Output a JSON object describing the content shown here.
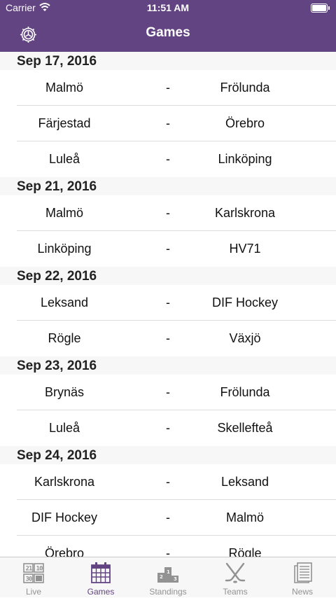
{
  "status_bar": {
    "carrier": "Carrier",
    "time": "11:51 AM"
  },
  "nav": {
    "title": "Games"
  },
  "sections": [
    {
      "date": "Sep 17, 2016",
      "games": [
        {
          "home": "Malmö",
          "sep": "-",
          "away": "Frölunda"
        },
        {
          "home": "Färjestad",
          "sep": "-",
          "away": "Örebro"
        },
        {
          "home": "Luleå",
          "sep": "-",
          "away": "Linköping"
        }
      ]
    },
    {
      "date": "Sep 21, 2016",
      "games": [
        {
          "home": "Malmö",
          "sep": "-",
          "away": "Karlskrona"
        },
        {
          "home": "Linköping",
          "sep": "-",
          "away": "HV71"
        }
      ]
    },
    {
      "date": "Sep 22, 2016",
      "games": [
        {
          "home": "Leksand",
          "sep": "-",
          "away": "DIF Hockey"
        },
        {
          "home": "Rögle",
          "sep": "-",
          "away": "Växjö"
        }
      ]
    },
    {
      "date": "Sep 23, 2016",
      "games": [
        {
          "home": "Brynäs",
          "sep": "-",
          "away": "Frölunda"
        },
        {
          "home": "Luleå",
          "sep": "-",
          "away": "Skellefteå"
        }
      ]
    },
    {
      "date": "Sep 24, 2016",
      "games": [
        {
          "home": "Karlskrona",
          "sep": "-",
          "away": "Leksand"
        },
        {
          "home": "DIF Hockey",
          "sep": "-",
          "away": "Malmö"
        },
        {
          "home": "Örebro",
          "sep": "-",
          "away": "Rögle"
        }
      ]
    }
  ],
  "tabs": [
    {
      "label": "Live",
      "icon": "scoreboard-icon"
    },
    {
      "label": "Games",
      "icon": "calendar-icon",
      "active": true
    },
    {
      "label": "Standings",
      "icon": "podium-icon"
    },
    {
      "label": "Teams",
      "icon": "hockey-sticks-icon"
    },
    {
      "label": "News",
      "icon": "newspaper-icon"
    }
  ],
  "colors": {
    "accent": "#634482",
    "tab_inactive": "#929292",
    "section_bg": "#f7f7f7"
  }
}
